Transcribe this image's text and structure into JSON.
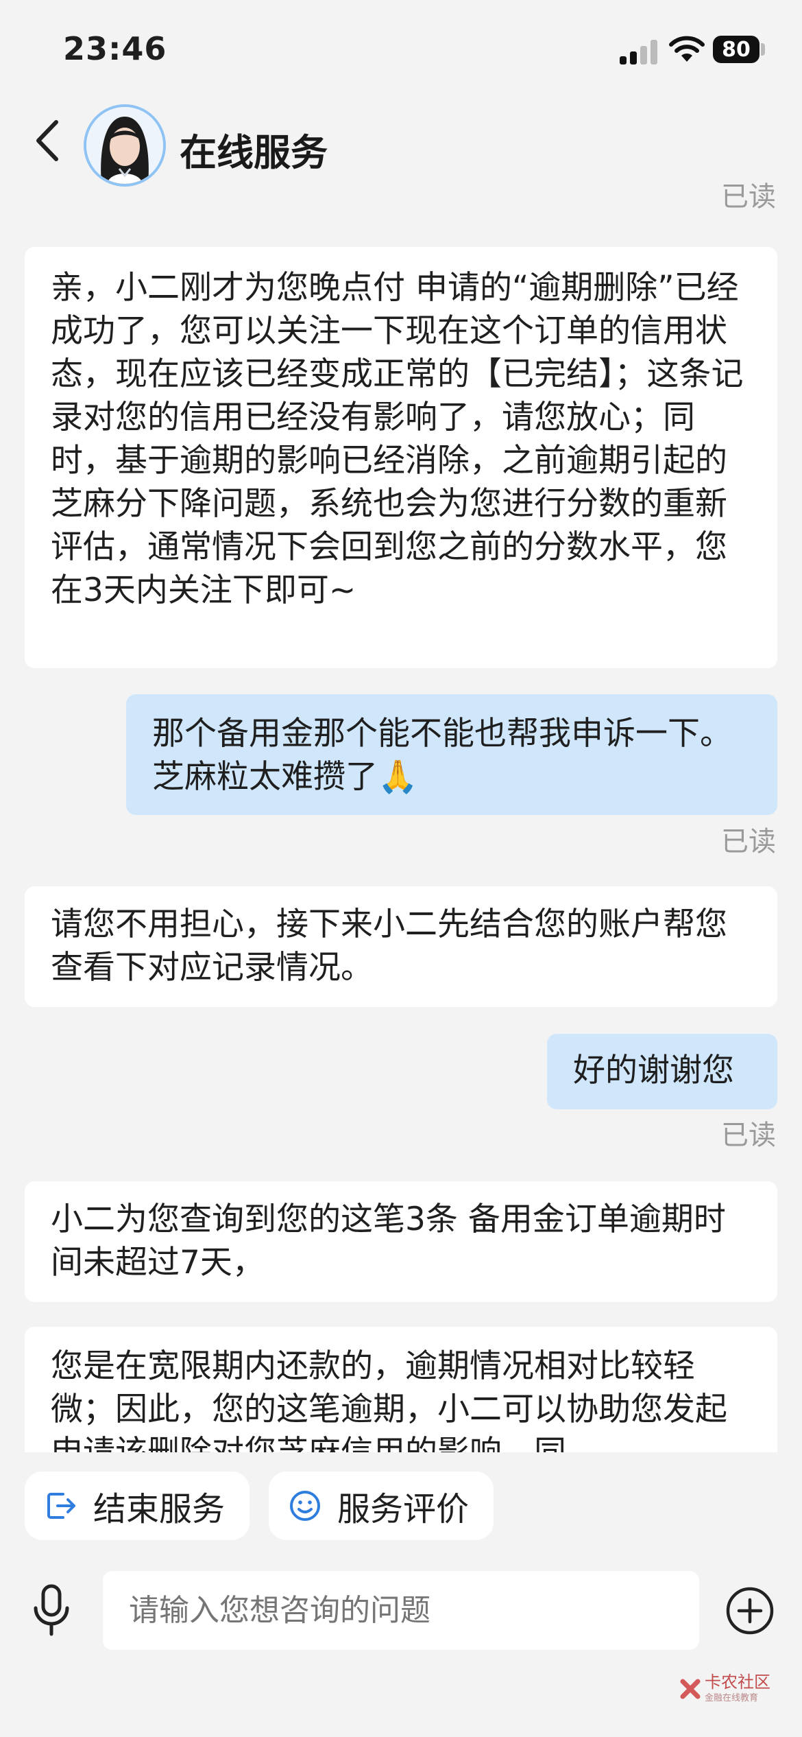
{
  "status_bar": {
    "time": "23:46",
    "battery": "80"
  },
  "header": {
    "title": "在线服务"
  },
  "messages": {
    "read_top": "已读",
    "m1": "亲，小二刚才为您晚点付 申请的“逾期删除”已经成功了，您可以关注一下现在这个订单的信用状态，现在应该已经变成正常的【已完结】；这条记录对您的信用已经没有影响了，请您放心；同时，基于逾期的影响已经消除，之前逾期引起的芝麻分下降问题，系统也会为您进行分数的重新评估，通常情况下会回到您之前的分数水平，您在3天内关注下即可~",
    "m2": "那个备用金那个能不能也帮我申诉一下。芝麻粒太难攒了🙏",
    "read_2": "已读",
    "m3": "请您不用担心，接下来小二先结合您的账户帮您查看下对应记录情况。",
    "m4": "好的谢谢您",
    "read_4": "已读",
    "m5": "小二为您查询到您的这笔3条 备用金订单逾期时间未超过7天，",
    "m6": "您是在宽限期内还款的，逾期情况相对比较轻微；因此，您的这笔逾期，小二可以协助您发起申请该删除对您芝麻信用的影响，同"
  },
  "actions": {
    "end_service": "结束服务",
    "rate_service": "服务评价"
  },
  "input": {
    "placeholder": "请输入您想咨询的问题"
  },
  "watermark": {
    "name": "卡农社区",
    "sub": "金融在线教育"
  },
  "colors": {
    "background": "#f3f3f4",
    "outgoing_bubble": "#cfe6fb",
    "incoming_bubble": "#ffffff",
    "accent": "#2f7ddf"
  }
}
